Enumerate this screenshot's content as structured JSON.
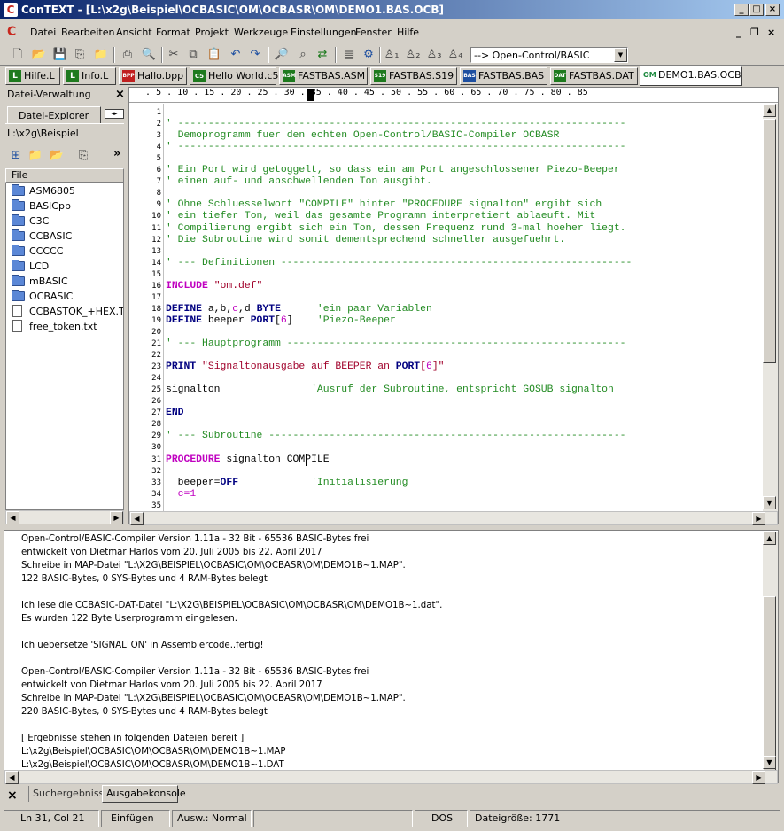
{
  "window": {
    "title": "ConTEXT - [L:\\x2g\\Beispiel\\OCBASIC\\OM\\OCBASR\\OM\\DEMO1.BAS.OCB]"
  },
  "menu": [
    "Datei",
    "Bearbeiten",
    "Ansicht",
    "Format",
    "Projekt",
    "Werkzeuge",
    "Einstellungen",
    "Fenster",
    "Hilfe"
  ],
  "toolbar": {
    "highlighter": "--> Open-Control/BASIC"
  },
  "tabs": [
    "Hilfe.L",
    "Info.L",
    "Hallo.bpp",
    "Hello World.c5",
    "FASTBAS.ASM",
    "FASTBAS.S19",
    "FASTBAS.BAS",
    "FASTBAS.DAT",
    "DEMO1.BAS.OCB"
  ],
  "tab_icons": [
    "L",
    "L",
    "BPP",
    "C5",
    "ASM",
    "S19",
    "BAS",
    "DAT",
    "OM"
  ],
  "left": {
    "title": "Datei-Verwaltung",
    "tab": "Datei-Explorer",
    "path": "L:\\x2g\\Beispiel",
    "col": "File",
    "items": [
      "ASM6805",
      "BASICpp",
      "C3C",
      "CCBASIC",
      "CCCCC",
      "LCD",
      "mBASIC",
      "OCBASIC",
      "CCBASTOK_+HEX.TXT",
      "free_token.txt"
    ]
  },
  "ruler": {
    "text": "   . 5 . 10 . 15 . 20 . 25 . 30 . 35 . 40 . 45 . 50 . 55 . 60 . 65 . 70 . 75 . 80 . 85"
  },
  "code": [
    "",
    "' --------------------------------------------------------------------------",
    "  Demoprogramm fuer den echten Open-Control/BASIC-Compiler OCBASR",
    "' --------------------------------------------------------------------------",
    "",
    "' Ein Port wird getoggelt, so dass ein am Port angeschlossener Piezo-Beeper",
    "' einen auf- und abschwellenden Ton ausgibt.",
    "",
    "' Ohne Schluesselwort \"COMPILE\" hinter \"PROCEDURE signalton\" ergibt sich",
    "' ein tiefer Ton, weil das gesamte Programm interpretiert ablaeuft. Mit",
    "' Compilierung ergibt sich ein Ton, dessen Frequenz rund 3-mal hoeher liegt.",
    "' Die Subroutine wird somit dementsprechend schneller ausgefuehrt.",
    "",
    "' --- Definitionen ----------------------------------------------------------",
    "",
    "INCLUDE \"om.def\"",
    "",
    "DEFINE a,b,c,d BYTE      'ein paar Variablen",
    "DEFINE beeper PORT[6]    'Piezo-Beeper",
    "",
    "' --- Hauptprogramm --------------------------------------------------------",
    "",
    "PRINT \"Signaltonausgabe auf BEEPER an PORT[6]\"",
    "",
    "signalton               'Ausruf der Subroutine, entspricht GOSUB signalton",
    "",
    "END",
    "",
    "' --- Subroutine -----------------------------------------------------------",
    "",
    "PROCEDURE signalton COMPILE",
    "",
    "  beeper=OFF            'Initialisierung",
    "  c=1",
    ""
  ],
  "console": [
    "Open-Control/BASIC-Compiler Version 1.11a - 32 Bit - 65536 BASIC-Bytes frei",
    "entwickelt von Dietmar Harlos vom 20. Juli 2005 bis 22. April 2017",
    "Schreibe in MAP-Datei \"L:\\X2G\\BEISPIEL\\OCBASIC\\OM\\OCBASR\\OM\\DEMO1B~1.MAP\".",
    "122 BASIC-Bytes, 0 SYS-Bytes und 4 RAM-Bytes belegt",
    "",
    "Ich lese die CCBASIC-DAT-Datei \"L:\\X2G\\BEISPIEL\\OCBASIC\\OM\\OCBASR\\OM\\DEMO1B~1.dat\".",
    "Es wurden 122 Byte Userprogramm eingelesen.",
    "",
    "Ich uebersetze 'SIGNALTON' in Assemblercode..fertig!",
    "",
    "Open-Control/BASIC-Compiler Version 1.11a - 32 Bit - 65536 BASIC-Bytes frei",
    "entwickelt von Dietmar Harlos vom 20. Juli 2005 bis 22. April 2017",
    "Schreibe in MAP-Datei \"L:\\X2G\\BEISPIEL\\OCBASIC\\OM\\OCBASR\\OM\\DEMO1B~1.MAP\".",
    "220 BASIC-Bytes, 0 SYS-Bytes und 4 RAM-Bytes belegt",
    "",
    "[ Ergebnisse stehen in folgenden Dateien bereit ]",
    "L:\\x2g\\Beispiel\\OCBASIC\\OM\\OCBASR\\OM\\DEMO1B~1.MAP",
    "L:\\x2g\\Beispiel\\OCBASIC\\OM\\OCBASR\\OM\\DEMO1B~1.DAT"
  ],
  "console_tabs": [
    "Suchergebnisse",
    "Ausgabekonsole"
  ],
  "status": {
    "pos": "Ln 31, Col 21",
    "mode": "Einfügen",
    "sel": "Ausw.: Normal",
    "eol": "DOS",
    "size": "Dateigröße: 1771"
  },
  "colors": {
    "title_start": "#0a246a",
    "title_end": "#a6caf0",
    "comment": "#228b22",
    "keyword": "#000080",
    "string": "#a0002a",
    "face": "#d4d0c8"
  }
}
